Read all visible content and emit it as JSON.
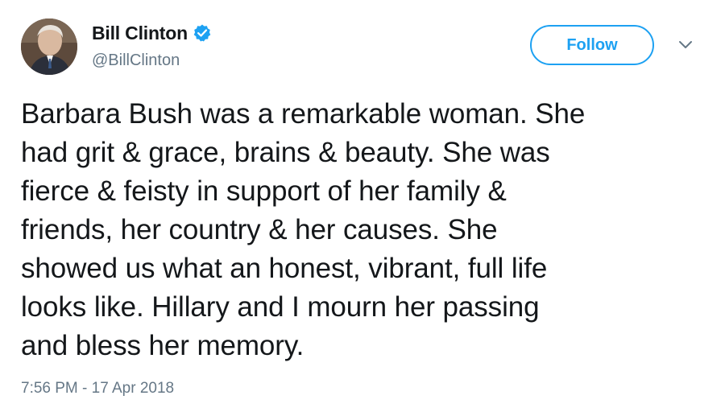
{
  "author": {
    "display_name": "Bill Clinton",
    "handle": "@BillClinton",
    "verified": true,
    "avatar_icon": "profile-photo"
  },
  "actions": {
    "follow_label": "Follow",
    "menu_icon": "chevron-down-icon"
  },
  "tweet": {
    "text": "Barbara Bush was a remarkable woman. She\nhad grit & grace, brains & beauty. She was\nfierce & feisty in support of her family &\nfriends, her country & her causes. She\nshowed us what an honest, vibrant, full life\nlooks like. Hillary and I mourn her passing\nand bless her memory.",
    "timestamp": "7:56 PM - 17 Apr 2018"
  },
  "colors": {
    "accent": "#1da1f2",
    "text": "#14171a",
    "secondary": "#657786"
  }
}
